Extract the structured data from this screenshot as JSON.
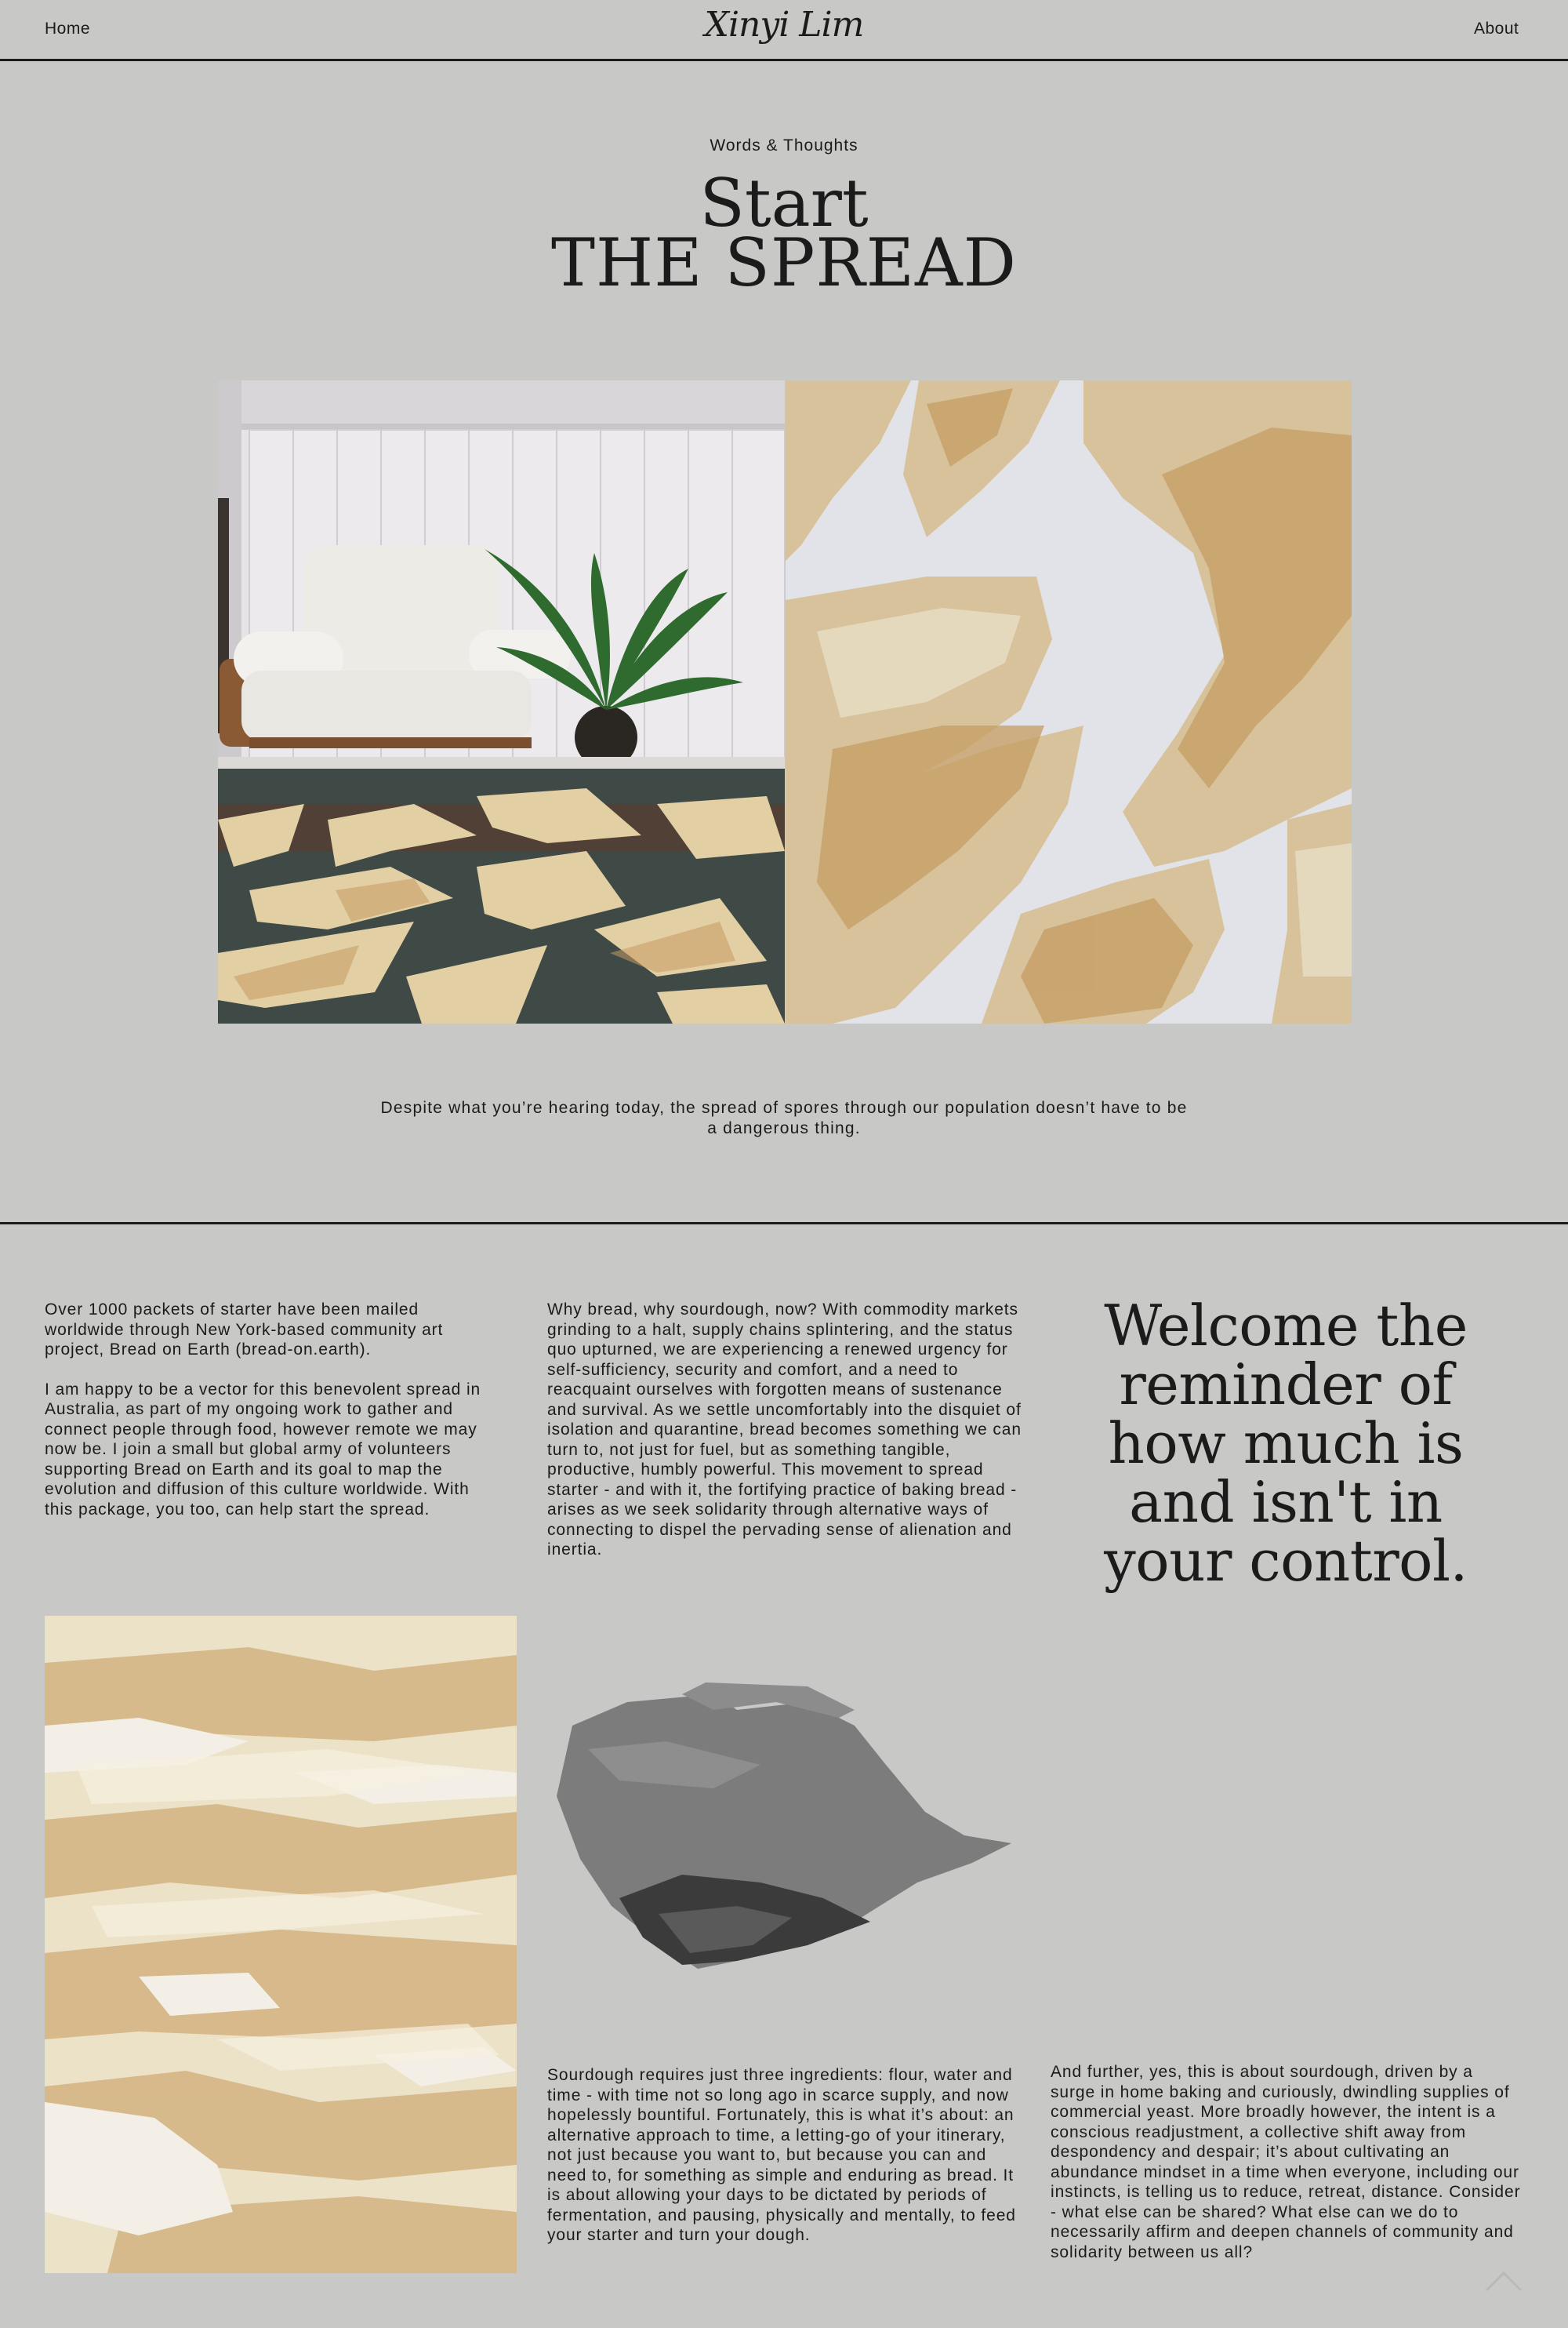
{
  "header": {
    "home_label": "Home",
    "logo_text": "Xinyi Lim",
    "about_label": "About"
  },
  "hero": {
    "kicker": "Words & Thoughts",
    "title_line1": "Start",
    "title_line2": "THE SPREAD",
    "lede": "Despite what you’re hearing today, the spread of spores through our population doesn’t have to be a dangerous thing."
  },
  "images": {
    "living_room": "photo of armchair, plant and bread skins on glass table",
    "bread_skins_closeup": "close-up photo of dried bread starter skins",
    "bread_texture": "photo of wrinkled bread starter texture",
    "bread_fragment_bw": "black and white photo of a bread starter fragment"
  },
  "content": {
    "col1_p1": "Over 1000 packets of starter have been mailed worldwide through New York-based community art project, Bread on Earth (bread-on.earth).",
    "col1_p2": "I am happy to be a vector for this benevolent spread in Australia, as part of my ongoing work to gather and connect people through food, however remote we may now be. I join a small but global army of volunteers supporting Bread on Earth and its goal to map the evolution and diffusion of this culture worldwide. With this package, you too, can help start the spread.",
    "col2_p1": "Why bread, why sourdough, now? With commodity markets grinding to a halt, supply chains splintering, and the status quo upturned, we are experiencing a renewed urgency for self-sufficiency, security and comfort, and a need to reacquaint ourselves with forgotten means of sustenance and survival. As we settle uncomfortably into the disquiet of isolation and quarantine, bread becomes something we can turn to, not just for fuel, but as something tangible, productive, humbly powerful. This movement to spread starter - and with it, the fortifying practice of baking bread - arises as we seek solidarity through alternative ways of connecting to dispel the pervading sense of alienation and inertia.",
    "quote": "Welcome the reminder of how much is and isn't in your control.",
    "col2_p2": "Sourdough requires just three ingredients: flour, water and time - with time not so long ago in scarce supply, and now hopelessly bountiful. Fortunately, this is what it’s about: an alternative approach to time, a letting-go of your itinerary, not just because you want to, but because you can and need to, for something as simple and enduring as bread. It is about allowing your days to be dictated by periods of fermentation, and pausing, physically and mentally, to feed your starter and turn your dough.",
    "col3_p1": "And further, yes, this is about sourdough, driven by a surge in home baking and curiously, dwindling supplies of commercial yeast. More broadly however, the intent is a conscious readjustment, a collective shift away from despondency and despair; it’s about cultivating an abundance mindset in a time when everyone, including our instincts, is telling us to reduce, retreat, distance. Consider - what else can be shared? What else can we do to necessarily affirm and deepen channels of community and solidarity between us all?"
  },
  "colors": {
    "background": "#c8c8c6",
    "text": "#1b1b1b"
  }
}
